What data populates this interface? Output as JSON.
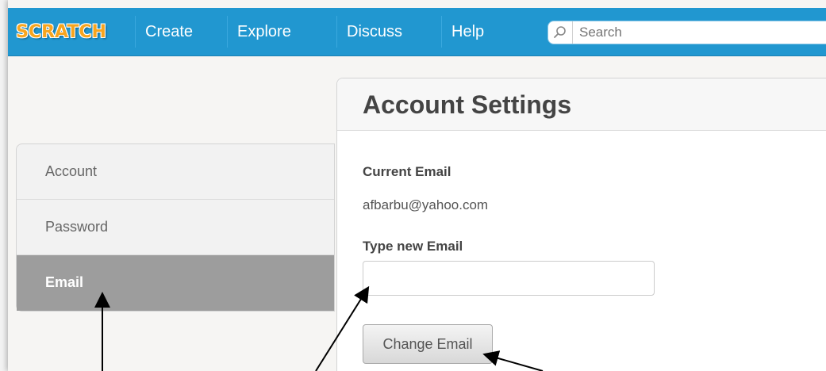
{
  "header": {
    "logo_text": "SCRATCH",
    "nav": [
      "Create",
      "Explore",
      "Discuss",
      "Help"
    ],
    "search_placeholder": "Search"
  },
  "sidebar": {
    "items": [
      {
        "label": "Account"
      },
      {
        "label": "Password"
      },
      {
        "label": "Email",
        "active": true
      }
    ]
  },
  "main": {
    "title": "Account Settings",
    "current_email_label": "Current Email",
    "current_email_value": "afbarbu@yahoo.com",
    "new_email_label": "Type new Email",
    "new_email_value": "",
    "change_button": "Change Email"
  },
  "colors": {
    "topbar": "#2197d0",
    "logo": "#f7a51f",
    "active_sidebar": "#9d9d9d"
  },
  "icons": [
    "search-icon",
    "annotation-arrow"
  ]
}
